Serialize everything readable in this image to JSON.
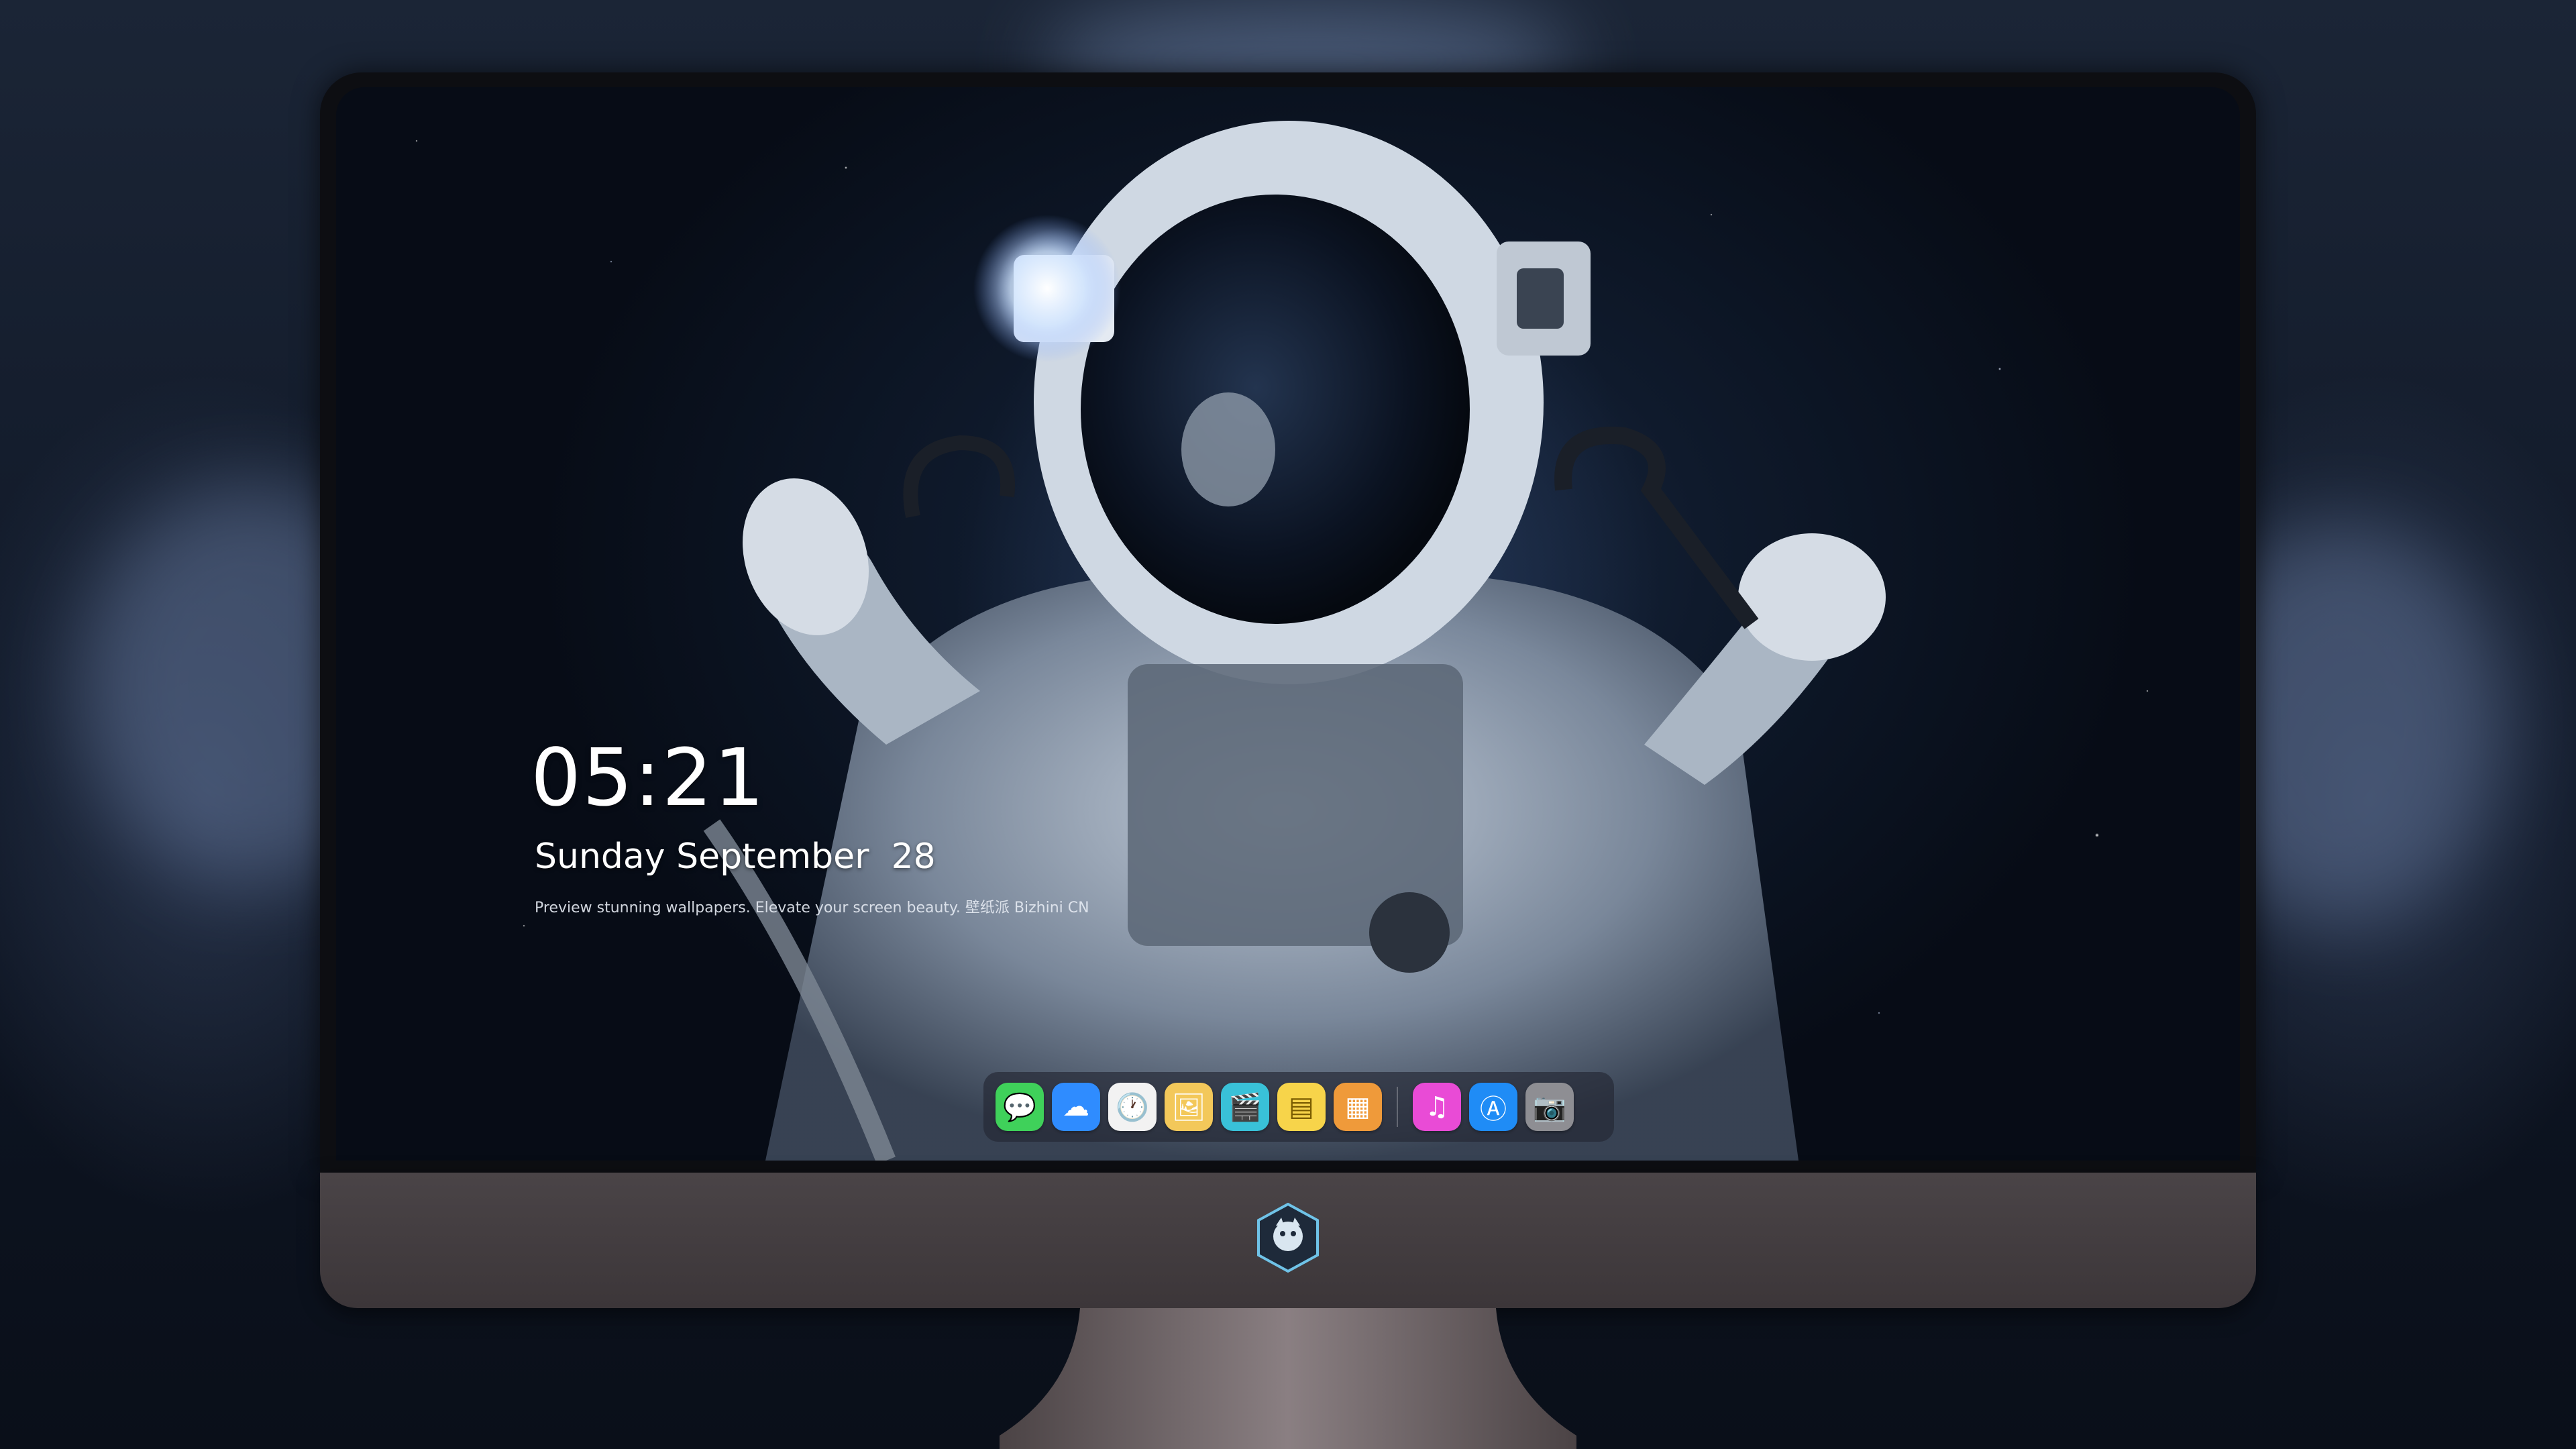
{
  "lockscreen": {
    "time": "05:21",
    "date": "Sunday September  28",
    "caption": "Preview stunning wallpapers. Elevate your screen beauty. 壁纸派 Bizhini CN"
  },
  "dock": {
    "apps": [
      {
        "name": "messages-icon",
        "bg": "#3fd15a",
        "glyph": "💬"
      },
      {
        "name": "weather-icon",
        "bg": "#2f8cff",
        "glyph": "☁"
      },
      {
        "name": "clock-icon",
        "bg": "#f2f2f2",
        "glyph": "🕐"
      },
      {
        "name": "preview-icon",
        "bg": "#f3c85a",
        "glyph": "🖼"
      },
      {
        "name": "clips-icon",
        "bg": "#39c1d8",
        "glyph": "🎬"
      },
      {
        "name": "notes-icon",
        "bg": "#f7d44a",
        "glyph": "▤"
      },
      {
        "name": "photo-booth-icon",
        "bg": "#ef9a3a",
        "glyph": "▦"
      },
      {
        "name": "music-icon",
        "bg": "#e94bd6",
        "glyph": "♫"
      },
      {
        "name": "app-store-icon",
        "bg": "#1f8cf6",
        "glyph": "Ⓐ"
      },
      {
        "name": "camera-icon",
        "bg": "#8e8e93",
        "glyph": "📷"
      }
    ]
  },
  "colors": {
    "bezel": "#0d0e12",
    "chin": "#4a4447",
    "stand": "#6b6264"
  }
}
